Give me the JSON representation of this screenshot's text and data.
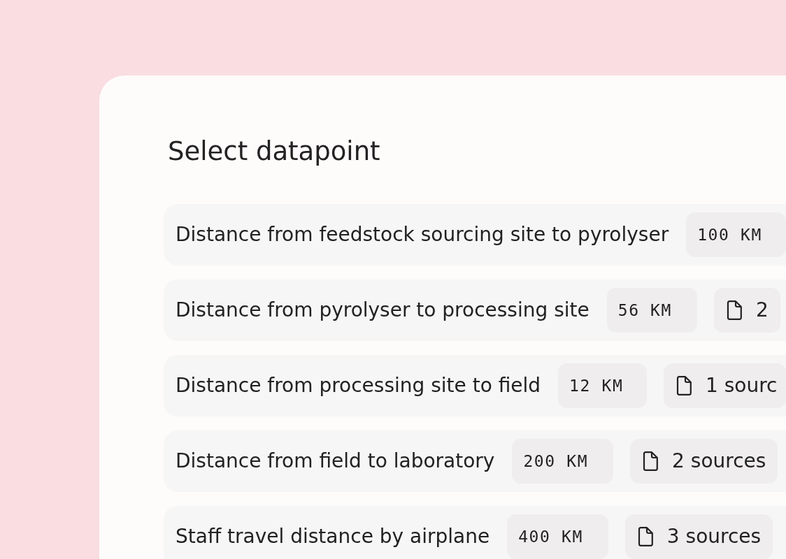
{
  "title": "Select datapoint",
  "datapoints": [
    {
      "label": "Distance from feedstock sourcing site to pyrolyser",
      "value": "100 KM"
    },
    {
      "label": "Distance from pyrolyser to processing site",
      "value": "56 KM",
      "sources": "2"
    },
    {
      "label": "Distance from processing site to field",
      "value": "12 KM",
      "sources": "1 sourc"
    },
    {
      "label": "Distance from field to laboratory",
      "value": "200 KM",
      "sources": "2 sources"
    },
    {
      "label": "Staff travel distance by airplane",
      "value": "400 KM",
      "sources": "3 sources"
    }
  ]
}
